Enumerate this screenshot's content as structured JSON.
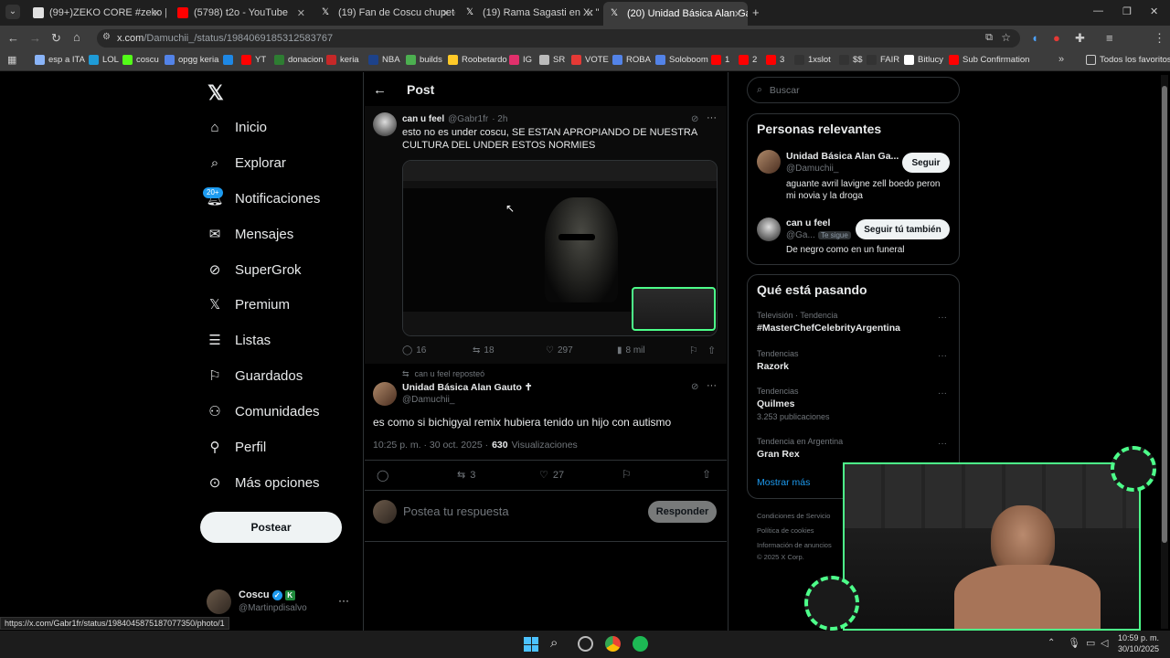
{
  "browser": {
    "tabs": [
      {
        "label": "(99+)ZEKO CORE #zeko | me ca",
        "color": "#e0e0e0"
      },
      {
        "label": "(5798) t2o - YouTube",
        "color": "#ff0000"
      },
      {
        "label": "(19) Fan de Coscu chupeton en",
        "color": "#e0e0e0"
      },
      {
        "label": "(19) Rama Sagasti en X: \"@Mar",
        "color": "#e0e0e0"
      },
      {
        "label": "(20) Unidad Básica Alan Gauto",
        "color": "#e0e0e0"
      }
    ],
    "url_host": "x.com",
    "url_path": "/Damuchii_/status/1984069185312583767",
    "bookmarks": [
      {
        "label": "esp a ITA",
        "color": "#8ab4f8"
      },
      {
        "label": "LOL",
        "color": "#1e9bd7"
      },
      {
        "label": "coscu",
        "color": "#53fc18"
      },
      {
        "label": "opgg keria",
        "color": "#5383e8"
      },
      {
        "label": "",
        "color": "#1e88e5"
      },
      {
        "label": "YT",
        "color": "#ff0000"
      },
      {
        "label": "donacion",
        "color": "#2e7d32"
      },
      {
        "label": "keria",
        "color": "#c62828"
      },
      {
        "label": "NBA",
        "color": "#1d428a"
      },
      {
        "label": "builds",
        "color": "#4caf50"
      },
      {
        "label": "Roobetardo",
        "color": "#ffca28"
      },
      {
        "label": "IG",
        "color": "#e1306c"
      },
      {
        "label": "SR",
        "color": "#bbbbbb"
      },
      {
        "label": "VOTE",
        "color": "#e53935"
      },
      {
        "label": "ROBA",
        "color": "#5383e8"
      },
      {
        "label": "Soloboom",
        "color": "#5383e8"
      },
      {
        "label": "1",
        "color": "#ff0000"
      },
      {
        "label": "2",
        "color": "#ff0000"
      },
      {
        "label": "3",
        "color": "#ff0000"
      },
      {
        "label": "1xslot",
        "color": "#333333"
      },
      {
        "label": "$$",
        "color": "#333333"
      },
      {
        "label": "FAIR",
        "color": "#333333"
      },
      {
        "label": "Bitlucy",
        "color": "#ffffff"
      },
      {
        "label": "Sub Confirmation",
        "color": "#ff0000"
      }
    ],
    "all_favorites": "Todos los favoritos",
    "status_url": "https://x.com/Gabr1fr/status/1984045875187077350/photo/1"
  },
  "nav": {
    "items": [
      {
        "label": "Inicio",
        "icon": "home-icon"
      },
      {
        "label": "Explorar",
        "icon": "search-icon"
      },
      {
        "label": "Notificaciones",
        "icon": "bell-icon"
      },
      {
        "label": "Mensajes",
        "icon": "mail-icon"
      },
      {
        "label": "SuperGrok",
        "icon": "grok-icon"
      },
      {
        "label": "Premium",
        "icon": "x-logo-icon"
      },
      {
        "label": "Listas",
        "icon": "list-icon"
      },
      {
        "label": "Guardados",
        "icon": "bookmark-icon"
      },
      {
        "label": "Comunidades",
        "icon": "people-icon"
      },
      {
        "label": "Perfil",
        "icon": "person-icon"
      },
      {
        "label": "Más opciones",
        "icon": "more-circle-icon"
      }
    ],
    "notif_badge": "20+",
    "post_button": "Postear",
    "account_name": "Coscu",
    "account_handle": "@Martinpdisalvo"
  },
  "header": {
    "title": "Post"
  },
  "quoted": {
    "name": "can u feel",
    "handle": "@Gabr1fr",
    "time": "· 2h",
    "text": "esto no es under coscu, SE ESTAN APROPIANDO DE NUESTRA CULTURA DEL UNDER ESTOS NORMIES",
    "replies": "16",
    "reposts": "18",
    "likes": "297",
    "views": "8 mil"
  },
  "main": {
    "repost_note": "can u feel reposteó",
    "name": "Unidad Básica Alan Gauto ✝",
    "handle": "@Damuchii_",
    "text": "es como si bichigyal remix hubiera tenido un hijo con autismo",
    "meta_time": "10:25 p. m. · 30 oct. 2025 ·",
    "views_count": "630",
    "views_label": "Visualizaciones",
    "reposts": "3",
    "likes": "27"
  },
  "reply": {
    "placeholder": "Postea tu respuesta",
    "button": "Responder"
  },
  "search": {
    "placeholder": "Buscar"
  },
  "relevant": {
    "title": "Personas relevantes",
    "people": [
      {
        "name": "Unidad Básica Alan Ga...",
        "handle": "@Damuchii_",
        "bio": "aguante avril lavigne zell boedo peron mi novia y la droga",
        "button": "Seguir"
      },
      {
        "name": "can u feel",
        "handle": "@Ga...",
        "follows_you": "Te sigue",
        "bio": "De negro como en un funeral",
        "button": "Seguir tú también"
      }
    ]
  },
  "trends": {
    "title": "Qué está pasando",
    "items": [
      {
        "context": "Televisión · Tendencia",
        "name": "#MasterChefCelebrityArgentina",
        "count": ""
      },
      {
        "context": "Tendencias",
        "name": "Razork",
        "count": ""
      },
      {
        "context": "Tendencias",
        "name": "Quilmes",
        "count": "3.253 publicaciones"
      },
      {
        "context": "Tendencia en Argentina",
        "name": "Gran Rex",
        "count": ""
      }
    ],
    "show_more": "Mostrar más"
  },
  "footer": {
    "links": [
      "Condiciones de Servicio",
      "Política de cookies",
      "Información de anuncios"
    ],
    "copyright": "© 2025 X Corp."
  },
  "taskbar": {
    "time": "10:59 p. m.",
    "date": "30/10/2025"
  },
  "colors": {
    "accent": "#1d9bf0",
    "bg": "#000000",
    "border": "#2f3336",
    "muted": "#71767b",
    "stream_green": "#4dff8a"
  }
}
